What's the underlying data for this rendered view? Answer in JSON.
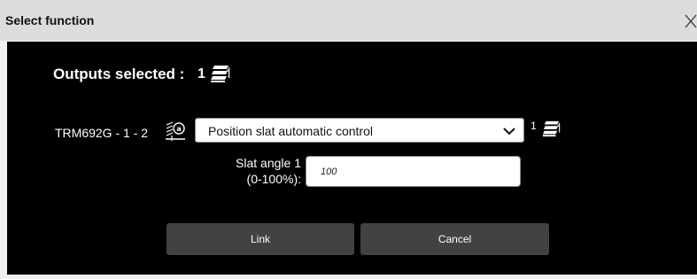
{
  "dialog": {
    "title": "Select function",
    "close_label": "×"
  },
  "outputs": {
    "label": "Outputs selected :",
    "count": "1",
    "icon": "slats-stack-icon"
  },
  "device": {
    "label": "TRM692G - 1 - 2",
    "icon": "blind-automatic-icon"
  },
  "function_select": {
    "selected": "Position slat automatic control",
    "icon": "chevron-down-icon"
  },
  "selection_count": {
    "count": "1",
    "icon": "slats-stack-icon"
  },
  "slat_angle": {
    "label_line1": "Slat angle 1",
    "label_line2": "(0-100%):",
    "value": "100"
  },
  "buttons": {
    "link": "Link",
    "cancel": "Cancel"
  },
  "colors": {
    "title_bar": "#dcdcdc",
    "panel": "#000000",
    "button": "#424242"
  }
}
